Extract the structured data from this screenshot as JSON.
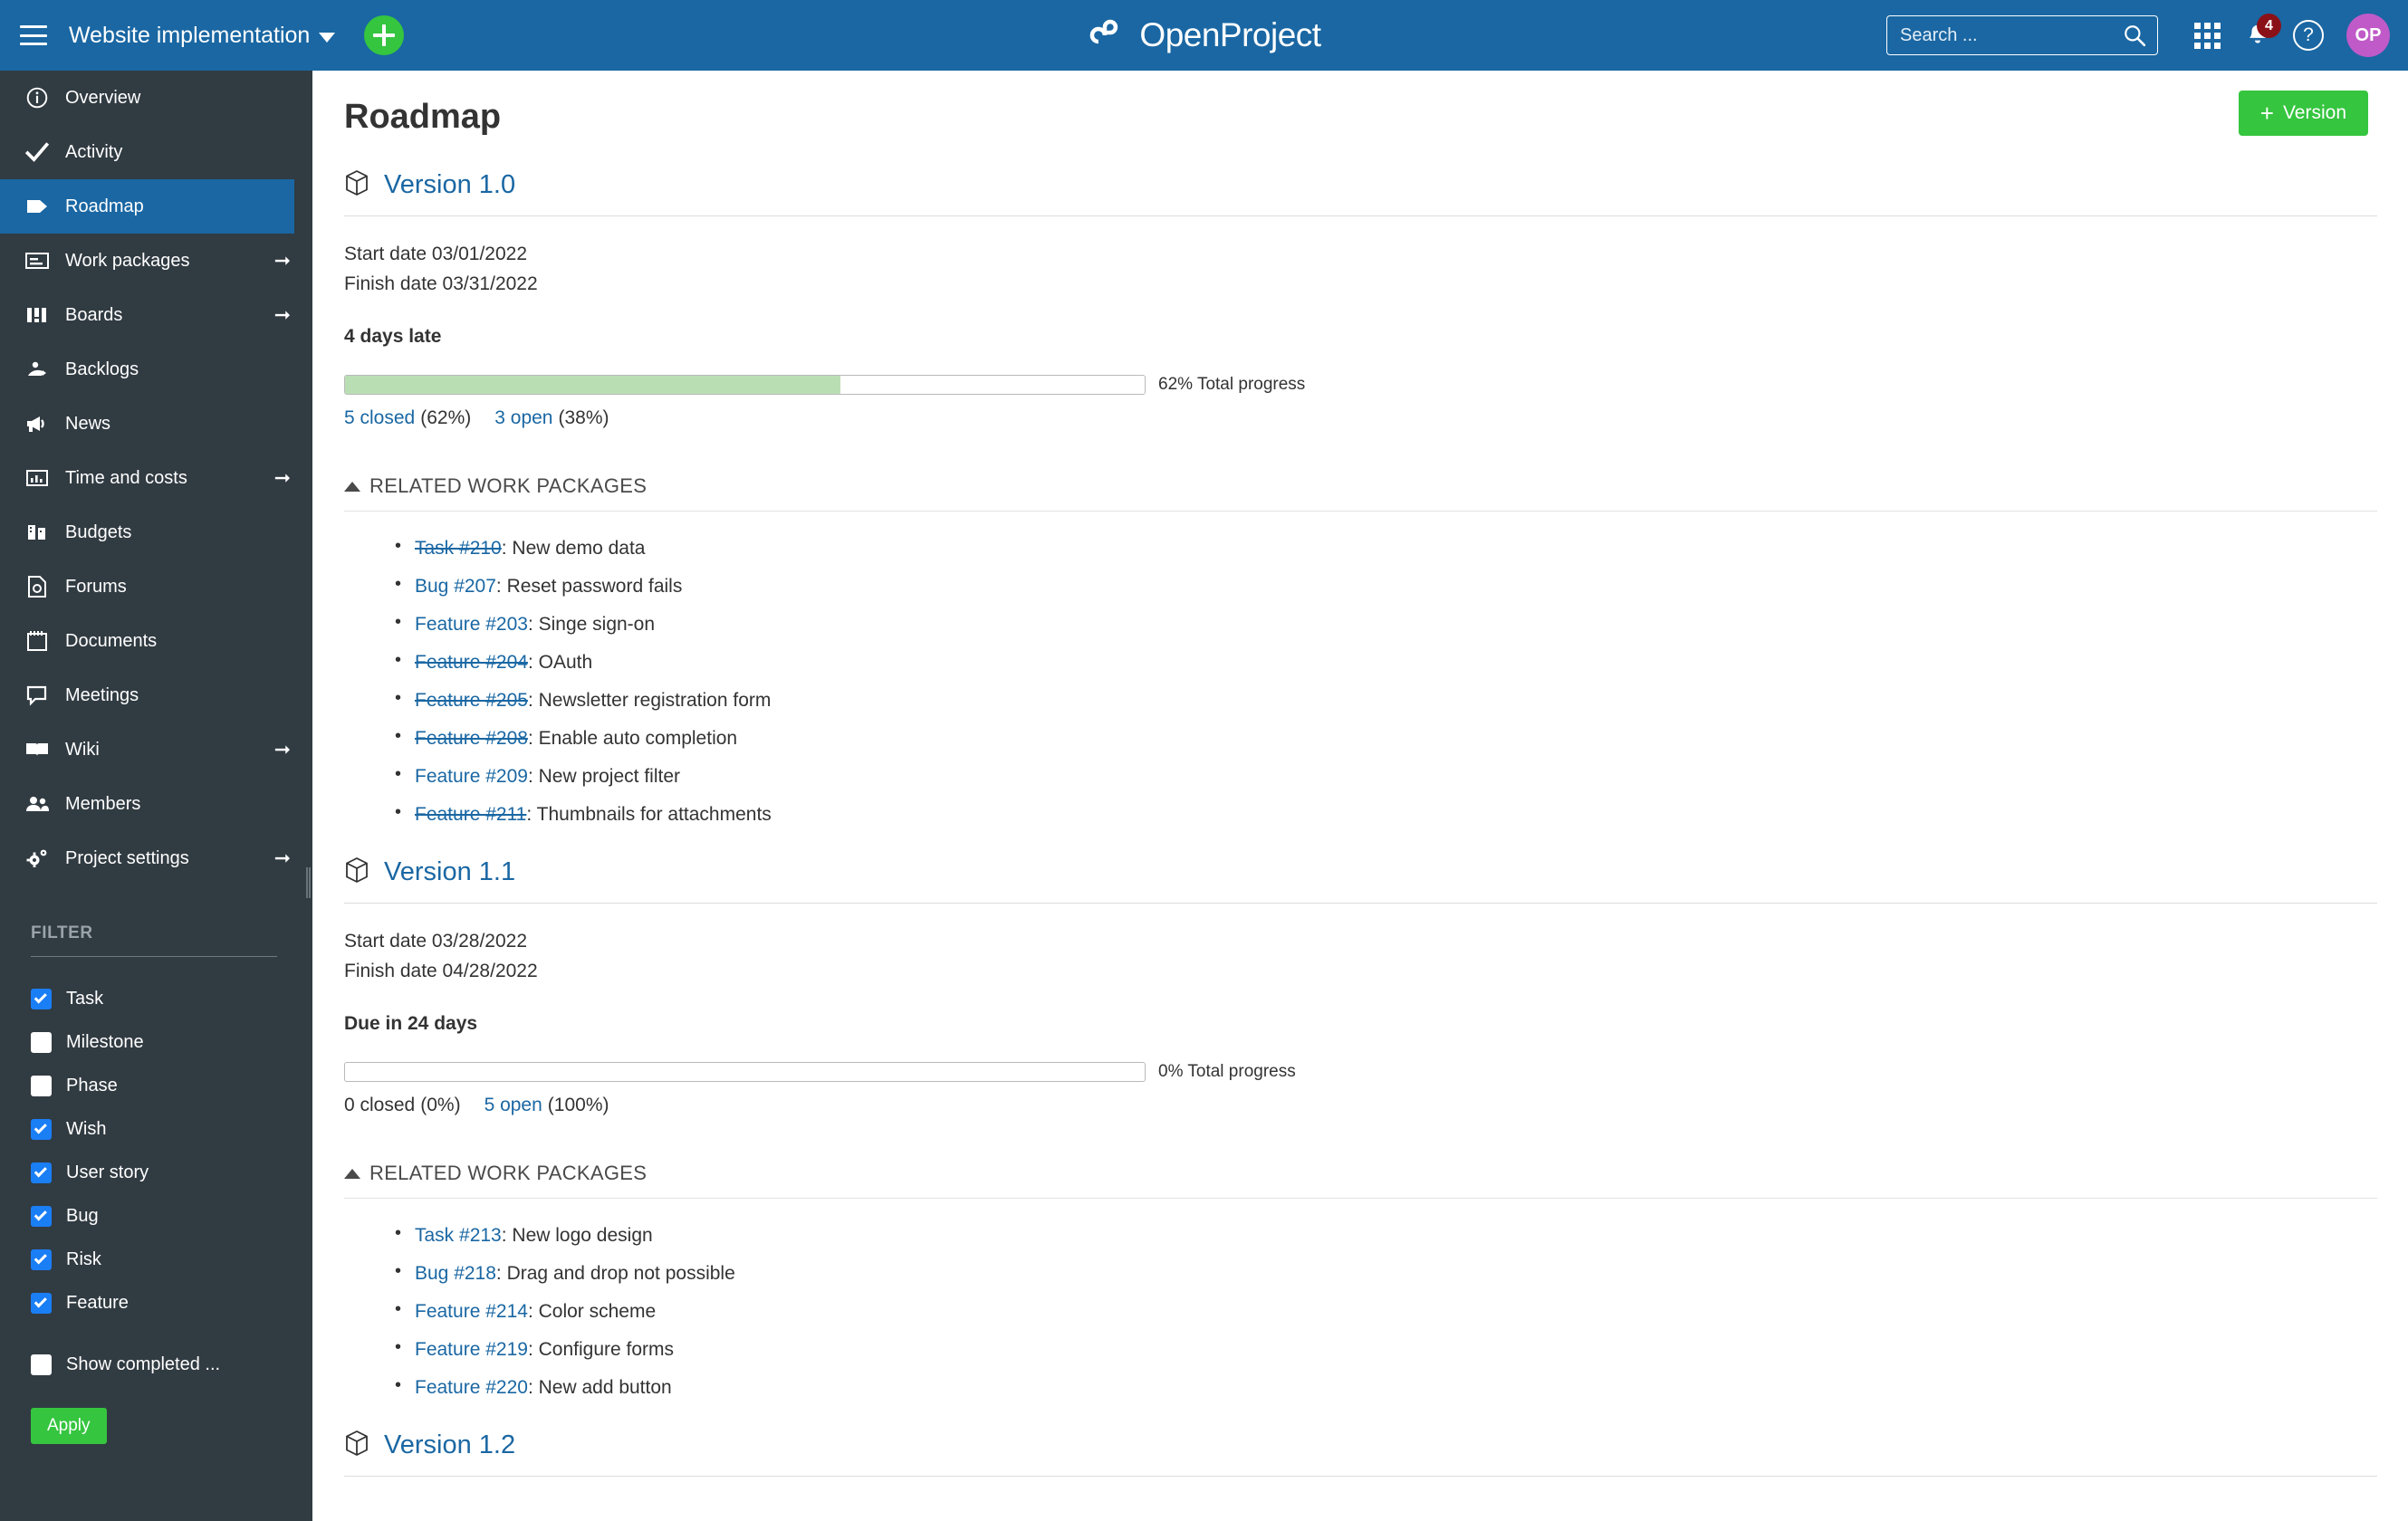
{
  "header": {
    "menu_icon": "hamburger-icon",
    "project_name": "Website implementation",
    "add_icon": "plus-icon",
    "logo_text": "OpenProject",
    "search_placeholder": "Search ...",
    "search_value": "",
    "search_icon": "search-icon",
    "modules_icon": "grid-icon",
    "notifications_icon": "bell-icon",
    "notifications_count": "4",
    "help_icon": "question-mark-icon",
    "avatar_initials": "OP"
  },
  "sidebar": {
    "items": [
      {
        "label": "Overview",
        "icon": "info-icon",
        "arrow": false,
        "active": false
      },
      {
        "label": "Activity",
        "icon": "checkmark-icon",
        "arrow": false,
        "active": false
      },
      {
        "label": "Roadmap",
        "icon": "tag-icon",
        "arrow": false,
        "active": true
      },
      {
        "label": "Work packages",
        "icon": "work-package-icon",
        "arrow": true,
        "active": false
      },
      {
        "label": "Boards",
        "icon": "boards-icon",
        "arrow": true,
        "active": false
      },
      {
        "label": "Backlogs",
        "icon": "backlogs-icon",
        "arrow": false,
        "active": false
      },
      {
        "label": "News",
        "icon": "megaphone-icon",
        "arrow": false,
        "active": false
      },
      {
        "label": "Time and costs",
        "icon": "chart-icon",
        "arrow": true,
        "active": false
      },
      {
        "label": "Budgets",
        "icon": "budget-icon",
        "arrow": false,
        "active": false
      },
      {
        "label": "Forums",
        "icon": "forum-icon",
        "arrow": false,
        "active": false
      },
      {
        "label": "Documents",
        "icon": "document-icon",
        "arrow": false,
        "active": false
      },
      {
        "label": "Meetings",
        "icon": "speech-bubble-icon",
        "arrow": false,
        "active": false
      },
      {
        "label": "Wiki",
        "icon": "book-icon",
        "arrow": true,
        "active": false
      },
      {
        "label": "Members",
        "icon": "people-icon",
        "arrow": false,
        "active": false
      },
      {
        "label": "Project settings",
        "icon": "gear-icon",
        "arrow": true,
        "active": false
      }
    ],
    "filter": {
      "title": "FILTER",
      "options": [
        {
          "label": "Task",
          "checked": true
        },
        {
          "label": "Milestone",
          "checked": false
        },
        {
          "label": "Phase",
          "checked": false
        },
        {
          "label": "Wish",
          "checked": true
        },
        {
          "label": "User story",
          "checked": true
        },
        {
          "label": "Bug",
          "checked": true
        },
        {
          "label": "Risk",
          "checked": true
        },
        {
          "label": "Feature",
          "checked": true
        }
      ],
      "show_completed": {
        "label": "Show completed ...",
        "checked": false
      },
      "apply_label": "Apply"
    }
  },
  "main": {
    "page_title": "Roadmap",
    "add_version_label": "Version",
    "add_version_icon": "plus-icon",
    "related_section_label": "RELATED WORK PACKAGES",
    "versions": [
      {
        "name": "Version 1.0",
        "icon": "cube-icon",
        "start_date_label": "Start date 03/01/2022",
        "finish_date_label": "Finish date 03/31/2022",
        "status_text": "4 days late",
        "progress_percent": 62,
        "progress_label": "62% Total progress",
        "closed_link": "5 closed",
        "closed_pct": "(62%)",
        "open_link": "3 open",
        "open_pct": "(38%)",
        "work_packages": [
          {
            "ref": "Task #210",
            "title": "New demo data",
            "closed": true
          },
          {
            "ref": "Bug #207",
            "title": "Reset password fails",
            "closed": false
          },
          {
            "ref": "Feature #203",
            "title": "Singe sign-on",
            "closed": false
          },
          {
            "ref": "Feature #204",
            "title": "OAuth",
            "closed": true
          },
          {
            "ref": "Feature #205",
            "title": "Newsletter registration form",
            "closed": true
          },
          {
            "ref": "Feature #208",
            "title": "Enable auto completion",
            "closed": true
          },
          {
            "ref": "Feature #209",
            "title": "New project filter",
            "closed": false
          },
          {
            "ref": "Feature #211",
            "title": "Thumbnails for attachments",
            "closed": true
          }
        ]
      },
      {
        "name": "Version 1.1",
        "icon": "cube-icon",
        "start_date_label": "Start date 03/28/2022",
        "finish_date_label": "Finish date 04/28/2022",
        "status_text": "Due in 24 days",
        "progress_percent": 0,
        "progress_label": "0% Total progress",
        "closed_link": "0 closed",
        "closed_pct": "(0%)",
        "open_link": "5 open",
        "open_pct": "(100%)",
        "work_packages": [
          {
            "ref": "Task #213",
            "title": "New logo design",
            "closed": false
          },
          {
            "ref": "Bug #218",
            "title": "Drag and drop not possible",
            "closed": false
          },
          {
            "ref": "Feature #214",
            "title": "Color scheme",
            "closed": false
          },
          {
            "ref": "Feature #219",
            "title": "Configure forms",
            "closed": false
          },
          {
            "ref": "Feature #220",
            "title": "New add button",
            "closed": false
          }
        ]
      },
      {
        "name": "Version 1.2",
        "icon": "cube-icon",
        "partial": true
      }
    ]
  },
  "colors": {
    "header_blue": "#1a67a3",
    "sidebar_dark": "#313b42",
    "accent_green": "#35c53f",
    "link_blue": "#1a67a3",
    "progress_green": "#badeb4",
    "badge_red": "#8b1119",
    "avatar_purple": "#bf5ac8"
  }
}
